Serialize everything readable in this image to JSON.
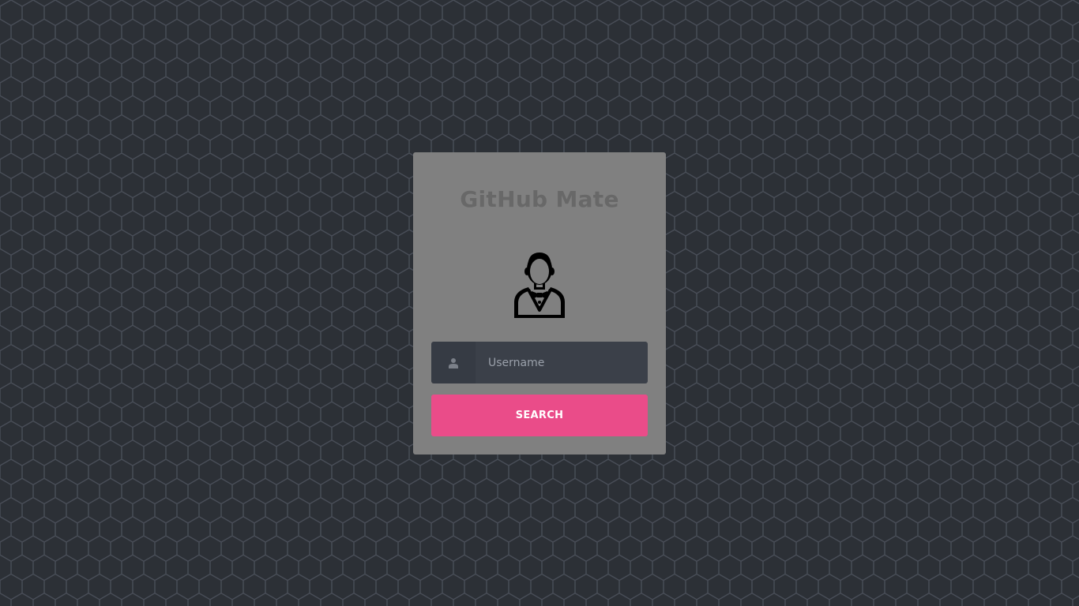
{
  "app": {
    "title": "GitHub Mate"
  },
  "avatar": {
    "icon": "butler-user-icon"
  },
  "search": {
    "prefix_icon": "user-icon",
    "placeholder": "Username",
    "value": "",
    "button_label": "SEARCH"
  },
  "colors": {
    "background": "#2c3036",
    "card": "#808080",
    "accent": "#ea4c89",
    "input_bg": "#3b4049"
  }
}
